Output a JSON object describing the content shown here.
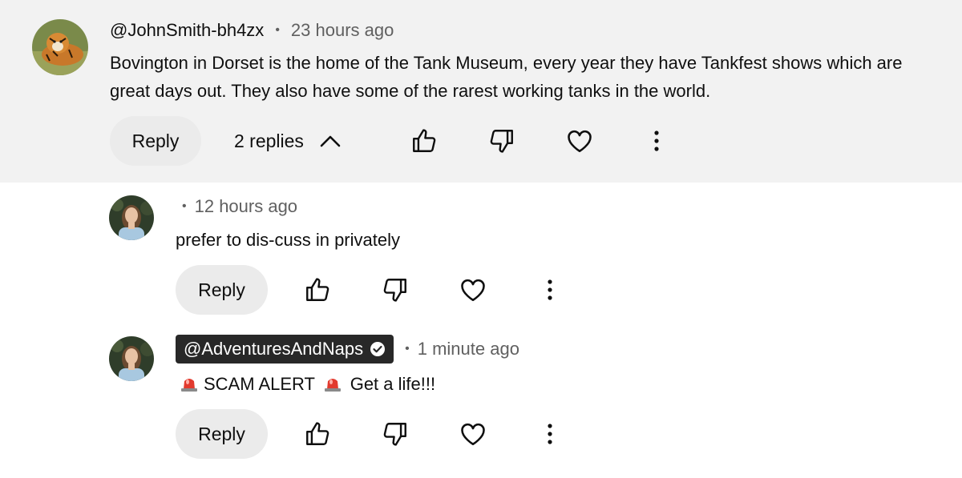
{
  "comment": {
    "author": "@JohnSmith-bh4zx",
    "separator": "•",
    "time": "23 hours ago",
    "text_line1": "Bovington in Dorset is the home of the Tank Museum, every year they have Tankfest shows which are",
    "text_line2": "great days out.  They also have some of the rarest working tanks in the world.",
    "reply_label": "Reply",
    "replies_label": "2 replies",
    "avatar_icon": "tiger-avatar"
  },
  "replies": [
    {
      "author": "",
      "separator": "•",
      "time": "12 hours ago",
      "text": "prefer to dis-cuss in privately",
      "reply_label": "Reply",
      "avatar_icon": "woman-avatar"
    },
    {
      "author": "@AdventuresAndNaps",
      "verified_icon": "verified-check-icon",
      "separator": "•",
      "time": "1 minute ago",
      "text_part1": "SCAM ALERT",
      "text_part2": "Get a life!!!",
      "alert_icon": "police-light-emoji",
      "reply_label": "Reply",
      "avatar_icon": "woman-avatar"
    }
  ],
  "colors": {
    "top_bg": "#f2f2f2",
    "pill_bg": "#ebebeb",
    "badge_bg": "#282828",
    "secondary_text": "#606060",
    "alert_red": "#d93025"
  }
}
